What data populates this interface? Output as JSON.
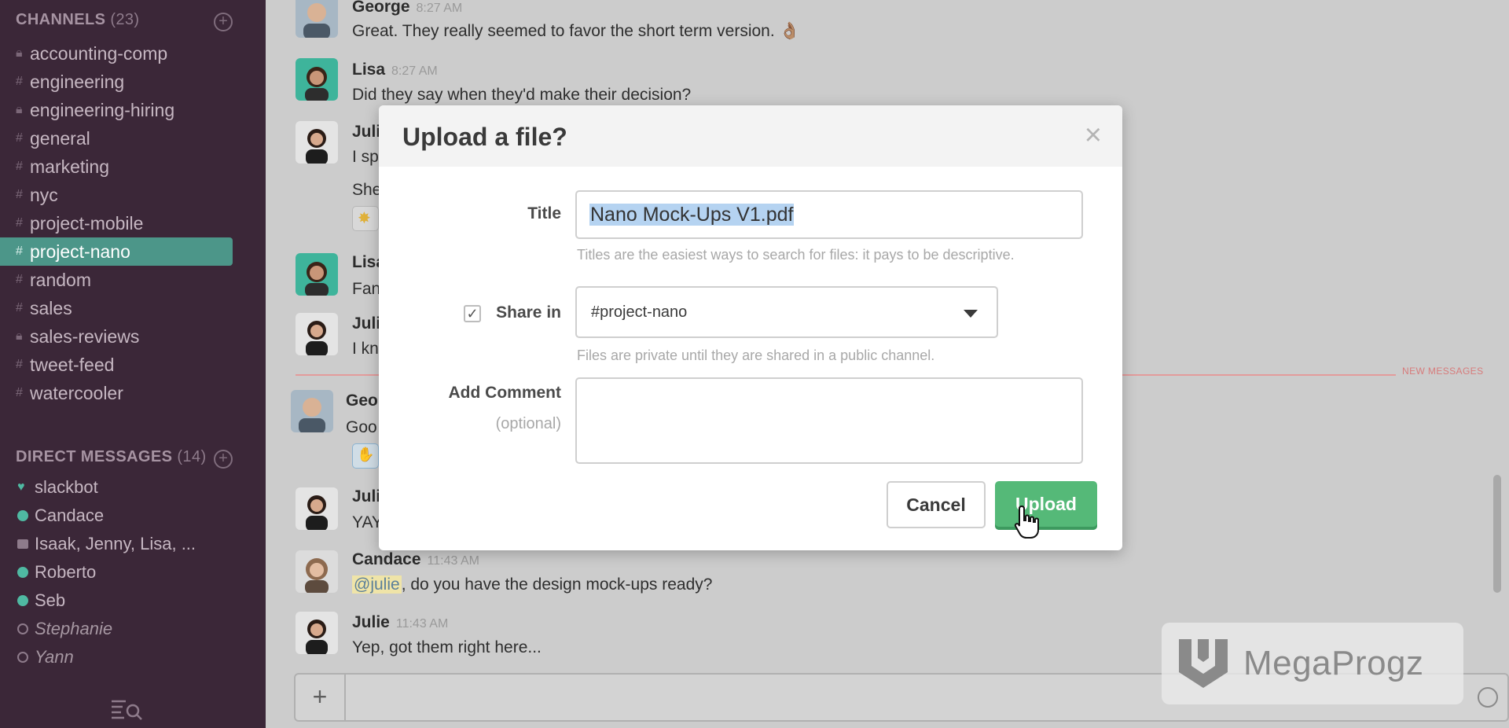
{
  "sidebar": {
    "channels_header": "CHANNELS",
    "channels_count": "(23)",
    "channels": [
      {
        "name": "accounting-comp",
        "type": "private"
      },
      {
        "name": "engineering",
        "type": "public"
      },
      {
        "name": "engineering-hiring",
        "type": "private"
      },
      {
        "name": "general",
        "type": "public"
      },
      {
        "name": "marketing",
        "type": "public"
      },
      {
        "name": "nyc",
        "type": "public"
      },
      {
        "name": "project-mobile",
        "type": "public"
      },
      {
        "name": "project-nano",
        "type": "public",
        "active": true
      },
      {
        "name": "random",
        "type": "public"
      },
      {
        "name": "sales",
        "type": "public"
      },
      {
        "name": "sales-reviews",
        "type": "private"
      },
      {
        "name": "tweet-feed",
        "type": "public"
      },
      {
        "name": "watercooler",
        "type": "public"
      }
    ],
    "dm_header": "DIRECT MESSAGES",
    "dm_count": "(14)",
    "dms": [
      {
        "name": "slackbot",
        "status": "bot"
      },
      {
        "name": "Candace",
        "status": "online"
      },
      {
        "name": "Isaak, Jenny, Lisa, ...",
        "status": "group"
      },
      {
        "name": "Roberto",
        "status": "online"
      },
      {
        "name": "Seb",
        "status": "online"
      },
      {
        "name": "Stephanie",
        "status": "away"
      },
      {
        "name": "Yann",
        "status": "away"
      }
    ]
  },
  "messages": {
    "george1": {
      "author": "George",
      "time": "8:27 AM",
      "text": "Great. They really seemed to favor the short term version. 👌🏽"
    },
    "lisa1": {
      "author": "Lisa",
      "time": "8:27 AM",
      "text": "Did they say when they'd make their decision?"
    },
    "julie1": {
      "author": "Juli",
      "line1": "I sp",
      "line2": "She"
    },
    "lisa2": {
      "author": "Lisa",
      "text": "Fan"
    },
    "julie2": {
      "author": "Juli",
      "text": "I kn"
    },
    "george2": {
      "author": "Geo",
      "text": "Goo"
    },
    "julie3": {
      "author": "Juli",
      "text": "YAY"
    },
    "candace": {
      "author": "Candace",
      "time": "11:43 AM",
      "mention": "@julie",
      "text": ", do you have the design mock-ups ready?"
    },
    "julie4": {
      "author": "Julie",
      "time": "11:43 AM",
      "text": "Yep, got them right here..."
    }
  },
  "new_messages_label": "NEW MESSAGES",
  "composer": {
    "plus": "+"
  },
  "watermark": {
    "text": "MegaProgz"
  },
  "modal": {
    "title": "Upload a file?",
    "close": "×",
    "title_label": "Title",
    "title_value": "Nano Mock-Ups V1.pdf",
    "title_hint": "Titles are the easiest ways to search for files: it pays to be descriptive.",
    "share_label": "Share in",
    "share_checked": true,
    "share_checkmark": "✓",
    "share_value": "#project-nano",
    "share_hint": "Files are private until they are shared in a public channel.",
    "comment_label": "Add Comment",
    "comment_optional": "(optional)",
    "cancel_label": "Cancel",
    "upload_label": "Upload"
  },
  "colors": {
    "sidebar_bg": "#3b2738",
    "active_channel": "#4c9689",
    "upload_button": "#55b978",
    "new_messages_line": "#e39b9b"
  }
}
